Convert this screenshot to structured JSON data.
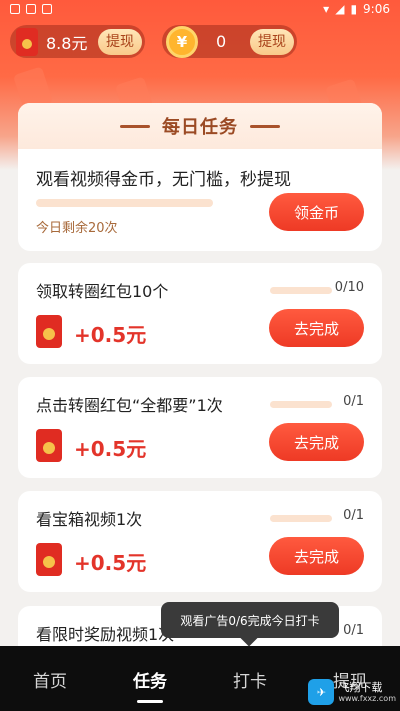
{
  "status_bar": {
    "time": "9:06"
  },
  "wallet": {
    "cash_amount": "8.8元",
    "cash_withdraw_label": "提现",
    "coin_symbol": "¥",
    "coin_amount": "0",
    "coin_withdraw_label": "提现"
  },
  "daily": {
    "section_title": "每日任务",
    "featured": {
      "title": "观看视频得金币，无门槛，秒提现",
      "remaining": "今日剩余20次",
      "button_label": "领金币"
    },
    "tasks": [
      {
        "title": "领取转圈红包10个",
        "progress_text": "0/10",
        "progress": 0,
        "reward": "+0.5元",
        "button_label": "去完成"
      },
      {
        "title": "点击转圈红包“全都要”1次",
        "progress_text": "0/1",
        "progress": 0,
        "reward": "+0.5元",
        "button_label": "去完成"
      },
      {
        "title": "看宝箱视频1次",
        "progress_text": "0/1",
        "progress": 0,
        "reward": "+0.5元",
        "button_label": "去完成"
      },
      {
        "title": "看限时奖励视频1次",
        "progress_text": "0/1",
        "progress": 0
      }
    ]
  },
  "toast": {
    "text": "观看广告0/6完成今日打卡"
  },
  "tabbar": {
    "items": [
      {
        "label": "首页",
        "active": false
      },
      {
        "label": "任务",
        "active": true
      },
      {
        "label": "打卡",
        "active": false
      },
      {
        "label": "提现",
        "active": false
      }
    ]
  },
  "watermark": {
    "name": "飞翔下载",
    "url": "www.fxxz.com"
  },
  "colors": {
    "accent": "#ee3a25",
    "reward": "#e3342a",
    "header_text": "#9b4a24"
  }
}
